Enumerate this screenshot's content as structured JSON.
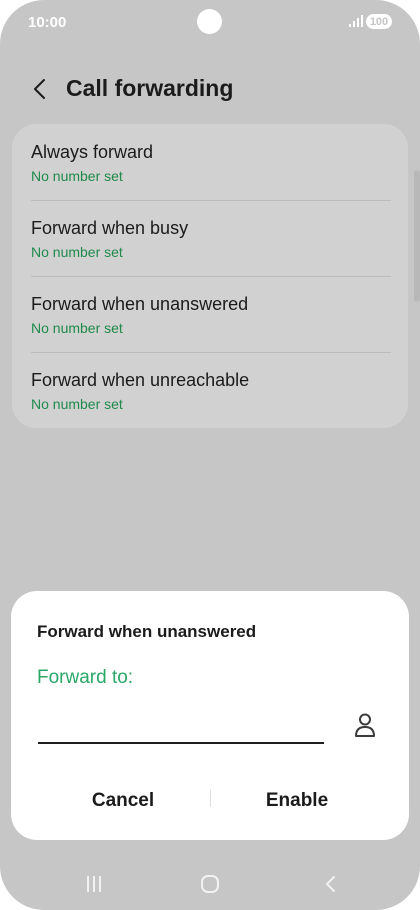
{
  "status_bar": {
    "time": "10:00",
    "battery": "100"
  },
  "header": {
    "title": "Call forwarding"
  },
  "options": [
    {
      "title": "Always forward",
      "subtitle": "No number set"
    },
    {
      "title": "Forward when busy",
      "subtitle": "No number set"
    },
    {
      "title": "Forward when unanswered",
      "subtitle": "No number set"
    },
    {
      "title": "Forward when unreachable",
      "subtitle": "No number set"
    }
  ],
  "dialog": {
    "title": "Forward when unanswered",
    "label": "Forward to:",
    "input_value": "",
    "cancel_label": "Cancel",
    "enable_label": "Enable"
  },
  "nav": {
    "icons": [
      "recent-apps-icon",
      "home-icon",
      "back-icon"
    ]
  },
  "colors": {
    "accent": "#2aa868",
    "subtitle": "#1f8a4c",
    "scrim": "#c6c6c6"
  }
}
